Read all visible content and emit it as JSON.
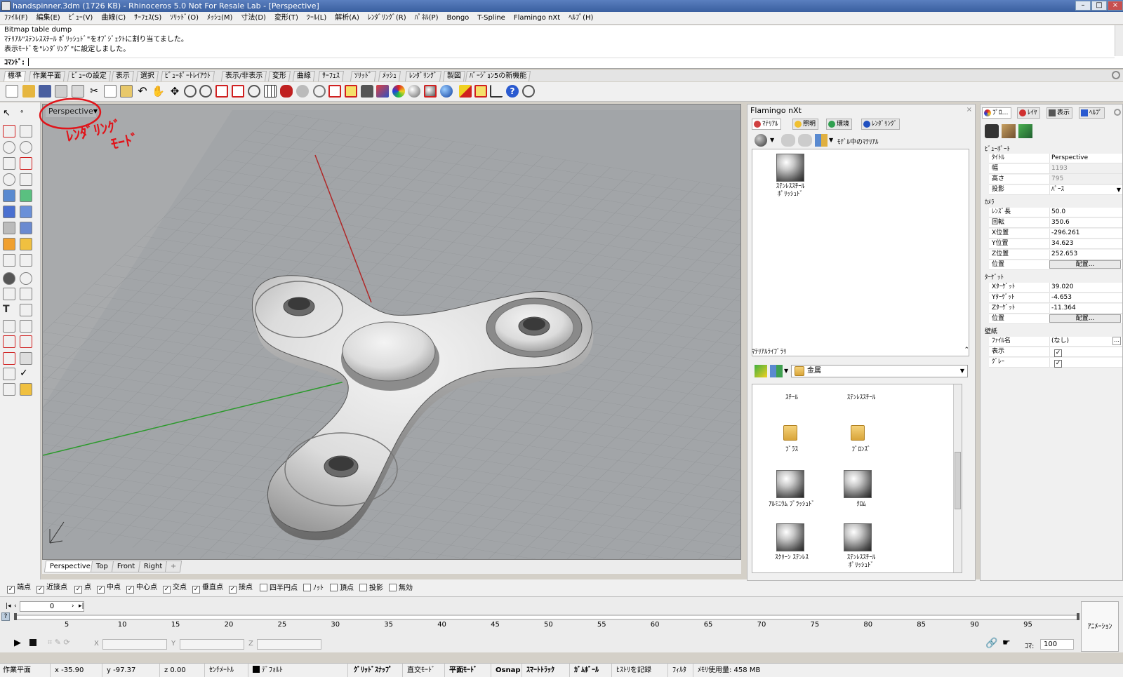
{
  "window": {
    "title": "handspinner.3dm (1726 KB) - Rhinoceros 5.0 Not For Resale Lab - [Perspective]"
  },
  "menu": [
    "ﾌｧｲﾙ(F)",
    "編集(E)",
    "ﾋﾞｭｰ(V)",
    "曲線(C)",
    "ｻｰﾌｪｽ(S)",
    "ｿﾘｯﾄﾞ(O)",
    "ﾒｯｼｭ(M)",
    "寸法(D)",
    "変形(T)",
    "ﾂｰﾙ(L)",
    "解析(A)",
    "ﾚﾝﾀﾞﾘﾝｸﾞ(R)",
    "ﾊﾟﾈﾙ(P)",
    "Bongo",
    "T-Spline",
    "Flamingo nXt",
    "ﾍﾙﾌﾟ(H)"
  ],
  "command": {
    "history": [
      "Bitmap table dump",
      "ﾏﾃﾘｱﾙ\"ｽﾃﾝﾚｽｽﾁｰﾙ ﾎﾟﾘｯｼｭﾄﾞ\"をｵﾌﾞｼﾞｪｸﾄに割り当てました。",
      "表示ﾓｰﾄﾞを\"ﾚﾝﾀﾞﾘﾝｸﾞ\"に設定しました。"
    ],
    "prompt": "ｺﾏﾝﾄﾞ:"
  },
  "toolbar_tabs": [
    "標準",
    "作業平面",
    "ﾋﾞｭｰの設定",
    "表示",
    "選択",
    "ﾋﾞｭｰﾎﾟｰﾄﾚｲｱｳﾄ",
    "表示/非表示",
    "変形",
    "曲線",
    "ｻｰﾌｪｽ",
    "ｿﾘｯﾄﾞ",
    "ﾒｯｼｭ",
    "ﾚﾝﾀﾞﾘﾝｸﾞ",
    "製図",
    "ﾊﾞｰｼﾞｮﾝ5の新機能"
  ],
  "viewport": {
    "title": "Perspective",
    "annotation_line1": "ﾚﾝﾀﾞﾘﾝｸﾞ",
    "annotation_line2": "ﾓｰﾄﾞ"
  },
  "viewport_tabs": [
    "Perspective",
    "Top",
    "Front",
    "Right"
  ],
  "osnaps": [
    {
      "label": "端点",
      "checked": true
    },
    {
      "label": "近接点",
      "checked": true
    },
    {
      "label": "点",
      "checked": true
    },
    {
      "label": "中点",
      "checked": true
    },
    {
      "label": "中心点",
      "checked": true
    },
    {
      "label": "交点",
      "checked": true
    },
    {
      "label": "垂直点",
      "checked": true
    },
    {
      "label": "接点",
      "checked": true
    },
    {
      "label": "四半円点",
      "checked": false
    },
    {
      "label": "ﾉｯﾄ",
      "checked": false
    },
    {
      "label": "頂点",
      "checked": false
    },
    {
      "label": "投影",
      "checked": false
    },
    {
      "label": "無効",
      "checked": false
    }
  ],
  "timeline": {
    "frame": "0",
    "ticks": [
      "5",
      "10",
      "15",
      "20",
      "25",
      "30",
      "35",
      "40",
      "45",
      "50",
      "55",
      "60",
      "65",
      "70",
      "75",
      "80",
      "85",
      "90",
      "95"
    ],
    "animation_button": "ｱﾆﾒｰｼｮﾝ",
    "field_x": "X",
    "field_y": "Y",
    "field_z": "Z",
    "koma_label": "ｺﾏ:",
    "koma_value": "100"
  },
  "status": {
    "cplane": "作業平面",
    "x": "x -35.90",
    "y": "y -97.37",
    "z": "z 0.00",
    "units": "ｾﾝﾁﾒｰﾄﾙ",
    "layer": "ﾃﾞﾌｫﾙﾄ",
    "toggles": [
      "ｸﾞﾘｯﾄﾞｽﾅｯﾌﾟ",
      "直交ﾓｰﾄﾞ",
      "平面ﾓｰﾄﾞ",
      "Osnap",
      "ｽﾏｰﾄﾄﾗｯｸ",
      "ｶﾞﾑﾎﾞｰﾙ",
      "ﾋｽﾄﾘを記録",
      "ﾌｨﾙﾀ"
    ],
    "memory": "ﾒﾓﾘ使用量: 458 MB"
  },
  "flamingo": {
    "title": "Flamingo nXt",
    "tabs": [
      "ﾏﾃﾘｱﾙ",
      "照明",
      "環境",
      "ﾚﾝﾀﾞﾘﾝｸﾞ"
    ],
    "model_materials_label": "ﾓﾃﾞﾙ中のﾏﾃﾘｱﾙ",
    "model_material_name_1": "ｽﾃﾝﾚｽｽﾁｰﾙ",
    "model_material_name_2": "ﾎﾟﾘｯｼｭﾄﾞ",
    "library_title": "ﾏﾃﾘｱﾙﾗｲﾌﾞﾗﾘ",
    "library_folder": "金属",
    "library_items": {
      "steel": "ｽﾁｰﾙ",
      "stainless": "ｽﾃﾝﾚｽｽﾁｰﾙ",
      "brass": "ﾌﾞﾗｽ",
      "bronze": "ﾌﾞﾛﾝｽﾞ",
      "aluminum": "ｱﾙﾐﾆｳﾑ ﾌﾞﾗｯｼｭﾄﾞ",
      "chrome": "ｸﾛﾑ",
      "screen": "ｽｸﾘｰﾝ ｽﾃﾝﾚｽ",
      "polished_1": "ｽﾃﾝﾚｽｽﾁｰﾙ",
      "polished_2": "ﾎﾟﾘｯｼｭﾄﾞ"
    }
  },
  "properties": {
    "tabs": [
      "ﾌﾟﾛ…",
      "ﾚｲﾔ",
      "表示",
      "ﾍﾙﾌﾟ"
    ],
    "viewport_section": "ﾋﾞｭｰﾎﾟｰﾄ",
    "title_label": "ﾀｲﾄﾙ",
    "title_value": "Perspective",
    "width_label": "幅",
    "width_value": "1193",
    "height_label": "高さ",
    "height_value": "795",
    "projection_label": "投影",
    "projection_value": "ﾊﾟｰｽ",
    "camera_section": "ｶﾒﾗ",
    "lens_label": "ﾚﾝｽﾞ長",
    "lens_value": "50.0",
    "rotation_label": "回転",
    "rotation_value": "350.6",
    "xpos_label": "X位置",
    "xpos_value": "-296.261",
    "ypos_label": "Y位置",
    "ypos_value": "34.623",
    "zpos_label": "Z位置",
    "zpos_value": "252.653",
    "pos_label": "位置",
    "place_button": "配置...",
    "target_section": "ﾀｰｹﾞｯﾄ",
    "xt_label": "Xﾀｰｹﾞｯﾄ",
    "xt_value": "39.020",
    "yt_label": "Yﾀｰｹﾞｯﾄ",
    "yt_value": "-4.653",
    "zt_label": "Zﾀｰｹﾞｯﾄ",
    "zt_value": "-11.364",
    "tpos_label": "位置",
    "tplace_button": "配置...",
    "wallpaper_section": "壁紙",
    "file_label": "ﾌｧｲﾙ名",
    "file_value": "(なし)",
    "show_label": "表示",
    "gray_label": "ｸﾞﾚｰ"
  }
}
